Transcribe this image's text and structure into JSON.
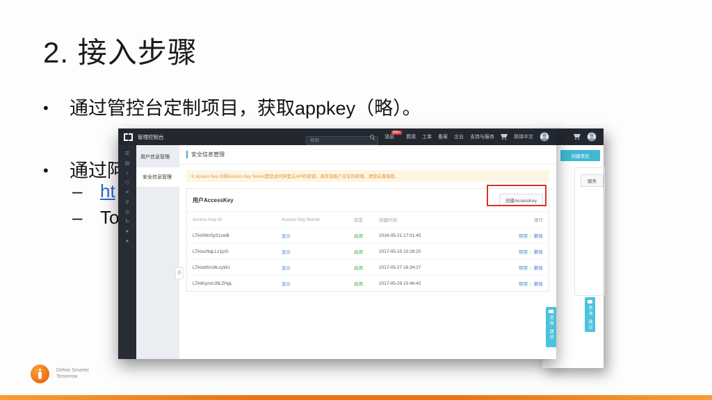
{
  "slide": {
    "title": "2. 接入步骤",
    "bullets": {
      "b1": "通过管控台定制项目，获取appkey（略）。",
      "b2_visible": "通过阿",
      "dash": "–",
      "sub_link_visible": "ht",
      "sub_text_visible": "To"
    },
    "logo": {
      "line1": "Define Smarter",
      "line2": "Tomorrow"
    }
  },
  "console": {
    "topbar": {
      "title": "管理控制台",
      "search_placeholder": "搜索",
      "msg": "消息",
      "badge": "999+",
      "nav1": "费用",
      "nav2": "工单",
      "nav3": "备案",
      "nav4": "企业",
      "nav5": "支持与服务",
      "lang": "简体中文"
    },
    "rail_icons": [
      "☰",
      "▤",
      "♁",
      "⬡",
      "✕",
      "⚲",
      "◎",
      "↻",
      "●",
      "●"
    ],
    "sidebar": {
      "item1": "用户信息管理",
      "item2": "安全信息管理"
    },
    "page_title": "安全信息管理",
    "warning": "① Access Key ID和Access Key Secret是您访问阿里云API的密钥，具有该账户完全的权限，请您妥善保管。",
    "panel": {
      "title": "用户AccessKey",
      "create_button": "创建AccessKey"
    },
    "table": {
      "h_id": "Access Key ID",
      "h_secret": "Access Key Secret",
      "h_status": "状态",
      "h_created": "创建时间",
      "h_actions": "操作",
      "rows": [
        {
          "id": "LTAI0Wz0yS1cwB",
          "secret": "显示",
          "status": "启用",
          "created": "2016-05-21 17:01:45",
          "a1": "禁用",
          "a2": "删除"
        },
        {
          "id": "LTAIocNqLLv1jzG",
          "secret": "显示",
          "status": "启用",
          "created": "2017-05-15 10:26:20",
          "a1": "禁用",
          "a2": "删除"
        },
        {
          "id": "LTAIob5rU8LzyWJ",
          "secret": "显示",
          "status": "启用",
          "created": "2017-05-27 16:34:37",
          "a1": "禁用",
          "a2": "删除"
        },
        {
          "id": "LTAIKyzonJ9LZHgL",
          "secret": "显示",
          "status": "启用",
          "created": "2017-05-29 15:46:42",
          "a1": "禁用",
          "a2": "删除"
        }
      ]
    },
    "feedback_tab": "咨询·建议"
  },
  "back_layer": {
    "create_project": "创建项目",
    "more_button": "服务",
    "feedback_tab": "咨询·建议"
  },
  "colors": {
    "teal": "#4cc2dc",
    "link_blue": "#4b83d8",
    "status_green": "#3fae57",
    "warning_text": "#ef8c23",
    "warning_bg": "#fdf6e5",
    "annotation_red": "#d9312a",
    "bar_orange": "#ec7414",
    "topbar_dark": "#232830"
  }
}
